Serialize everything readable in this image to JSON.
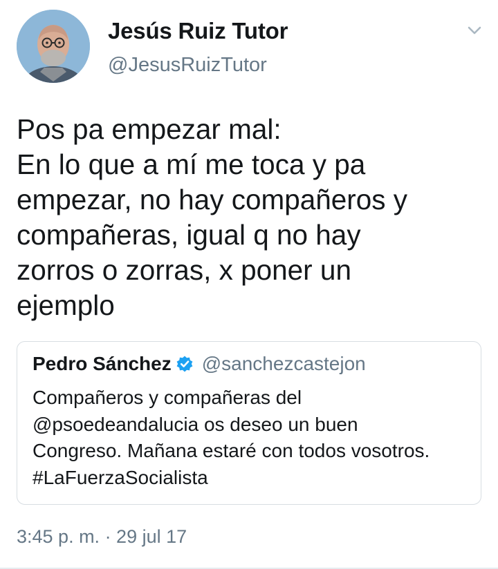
{
  "tweet": {
    "author": {
      "name": "Jesús Ruiz Tutor",
      "handle": "@JesusRuizTutor"
    },
    "text_lines": [
      "Pos pa empezar mal:",
      "En lo que a mí me toca y pa",
      "empezar, no hay compañeros y",
      "compañeras, igual q no hay",
      "zorros o zorras, x poner un",
      "ejemplo"
    ],
    "quoted": {
      "name": "Pedro Sánchez",
      "verified": true,
      "handle": "@sanchezcastejon",
      "text_lines": [
        "Compañeros y compañeras del",
        "@psoedeandalucia os deseo un buen",
        "Congreso. Mañana estaré con todos vosotros.",
        "#LaFuerzaSocialista"
      ]
    },
    "timestamp": "3:45 p. m. · 29 jul 17"
  },
  "icons": {
    "menu": "chevron-down-icon",
    "verified": "verified-badge-icon"
  },
  "colors": {
    "text": "#14171a",
    "secondary": "#657786",
    "verified": "#1da1f2",
    "border": "#d7dde2"
  }
}
